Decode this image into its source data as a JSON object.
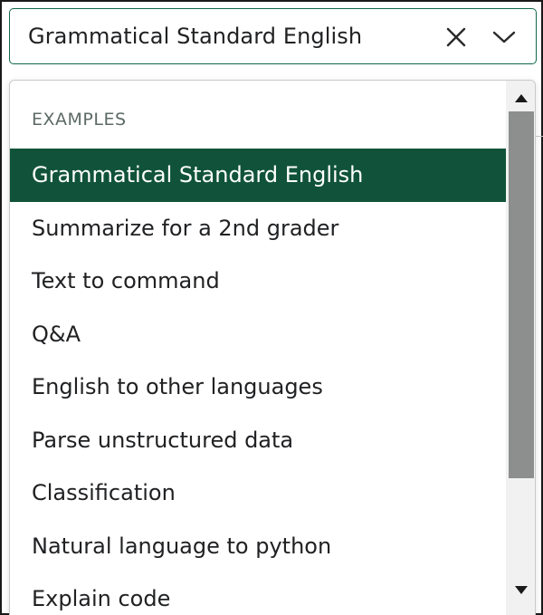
{
  "select": {
    "value": "Grammatical Standard English",
    "clear_icon": "close-icon",
    "toggle_icon": "chevron-down-icon"
  },
  "menu": {
    "group_label": "EXAMPLES",
    "selected_index": 0,
    "options": [
      {
        "label": "Grammatical Standard English"
      },
      {
        "label": "Summarize for a 2nd grader"
      },
      {
        "label": "Text to command"
      },
      {
        "label": "Q&A"
      },
      {
        "label": "English to other languages"
      },
      {
        "label": "Parse unstructured data"
      },
      {
        "label": "Classification"
      },
      {
        "label": "Natural language to python"
      },
      {
        "label": "Explain code"
      }
    ]
  },
  "colors": {
    "accent": "#10533a",
    "border": "#10684a",
    "group_label": "#5c6a64",
    "scroll_thumb": "#8d8f8e"
  }
}
